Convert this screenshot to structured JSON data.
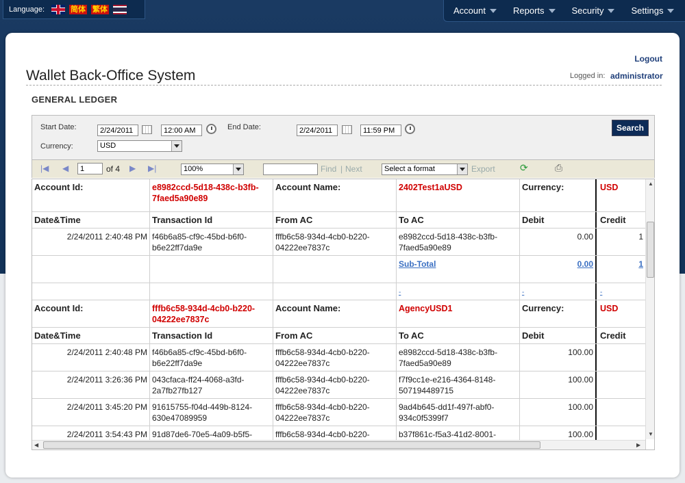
{
  "language": {
    "label": "Language:",
    "flags": [
      "uk-flag-icon",
      "thai-flag-icon"
    ],
    "simplified": "简体",
    "traditional": "繁体"
  },
  "menu": {
    "items": [
      {
        "label": "Account"
      },
      {
        "label": "Reports"
      },
      {
        "label": "Security"
      },
      {
        "label": "Settings"
      }
    ]
  },
  "header": {
    "title": "Wallet Back-Office System",
    "logout": "Logout",
    "logged_in_label": "Logged in:",
    "user": "administrator",
    "page_heading": "GENERAL LEDGER"
  },
  "filter": {
    "start_label": "Start Date:",
    "start_date": "2/24/2011",
    "start_time": "12:00 AM",
    "end_label": "End Date:",
    "end_date": "2/24/2011",
    "end_time": "11:59 PM",
    "currency_label": "Currency:",
    "currency": "USD",
    "search_label": "Search"
  },
  "toolbar": {
    "page": "1",
    "of_pages": "of 4",
    "zoom": "100%",
    "find": "Find",
    "separator": "|",
    "next": "Next",
    "format": "Select a format",
    "export": "Export"
  },
  "report": {
    "labels": {
      "account_id": "Account Id:",
      "account_name": "Account Name:",
      "currency": "Currency:",
      "subtotal": "Sub-Total"
    },
    "columns": [
      "Date&Time",
      "Transaction Id",
      "From AC",
      "To AC",
      "Debit",
      "Credit"
    ],
    "group1": {
      "account_id": "e8982ccd-5d18-438c-b3fb-7faed5a90e89",
      "account_name": "2402Test1aUSD",
      "currency": "USD",
      "rows": [
        {
          "date": "2/24/2011 2:40:48 PM",
          "txn": "f46b6a85-cf9c-45bd-b6f0-b6e22ff7da9e",
          "from": "fffb6c58-934d-4cb0-b220-04222ee7837c",
          "to": "e8982ccd-5d18-438c-b3fb-7faed5a90e89",
          "debit": "0.00",
          "credit": "1"
        }
      ],
      "subtotal_debit": "0.00",
      "subtotal_credit": "1",
      "dash": "-"
    },
    "group2": {
      "account_id": "fffb6c58-934d-4cb0-b220-04222ee7837c",
      "account_name": "AgencyUSD1",
      "currency": "USD",
      "rows": [
        {
          "date": "2/24/2011 2:40:48 PM",
          "txn": "f46b6a85-cf9c-45bd-b6f0-b6e22ff7da9e",
          "from": "fffb6c58-934d-4cb0-b220-04222ee7837c",
          "to": "e8982ccd-5d18-438c-b3fb-7faed5a90e89",
          "debit": "100.00"
        },
        {
          "date": "2/24/2011 3:26:36 PM",
          "txn": "043cfaca-ff24-4068-a3fd-2a7fb27fb127",
          "from": "fffb6c58-934d-4cb0-b220-04222ee7837c",
          "to": "f7f9cc1e-e216-4364-8148-507194489715",
          "debit": "100.00"
        },
        {
          "date": "2/24/2011 3:45:20 PM",
          "txn": "91615755-f04d-449b-8124-630e47089959",
          "from": "fffb6c58-934d-4cb0-b220-04222ee7837c",
          "to": "9ad4b645-dd1f-497f-abf0-934c0f5399f7",
          "debit": "100.00"
        },
        {
          "date": "2/24/2011 3:54:43 PM",
          "txn": "91d87de6-70e5-4a09-b5f5-",
          "from": "fffb6c58-934d-4cb0-b220-",
          "to": "b37f861c-f5a3-41d2-8001-",
          "debit": "100.00"
        }
      ]
    }
  }
}
